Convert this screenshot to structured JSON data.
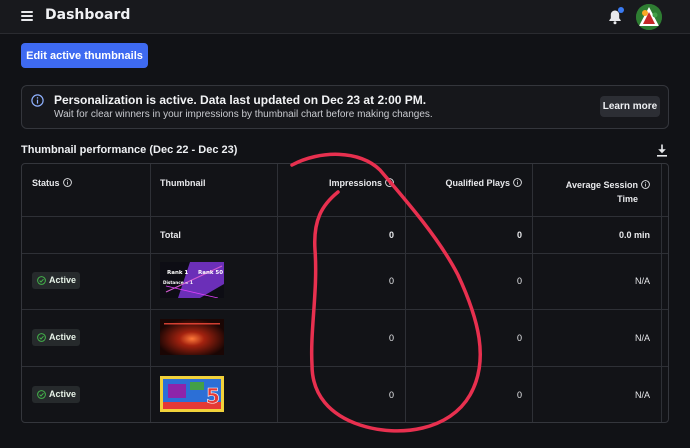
{
  "header": {
    "title": "Dashboard",
    "menu_icon": "hamburger-menu-icon",
    "notification_icon": "bell-icon",
    "notification_dot_color": "#3a7bf3"
  },
  "actions": {
    "edit_label": "Edit active thumbnails",
    "accent": "#3e6af1"
  },
  "info": {
    "title": "Personalization is active. Data last updated on Dec 23 at 2:00 PM.",
    "subtitle": "Wait for clear winners in your impressions by thumbnail chart before making changes.",
    "learn_more": "Learn more",
    "icon": "info-circle-icon"
  },
  "section": {
    "title": "Thumbnail performance (Dec 22 - Dec 23)",
    "download_icon": "download-icon"
  },
  "table": {
    "columns": {
      "status": "Status",
      "thumbnail": "Thumbnail",
      "impressions": "Impressions",
      "plays": "Qualified Plays",
      "session_line1": "Average Session",
      "session_line2": "Time"
    },
    "total": {
      "label": "Total",
      "impressions": "0",
      "plays": "0",
      "session": "0.0 min"
    },
    "rows": [
      {
        "status": "Active",
        "impressions": "0",
        "plays": "0",
        "session": "N/A",
        "thumb": {
          "rank_a": "Rank 1",
          "rank_b": "Rank 50",
          "distance": "Distance = 1"
        }
      },
      {
        "status": "Active",
        "impressions": "0",
        "plays": "0",
        "session": "N/A"
      },
      {
        "status": "Active",
        "impressions": "0",
        "plays": "0",
        "session": "N/A",
        "thumb": {
          "number": "5"
        }
      }
    ],
    "active_color": "#43b14a"
  }
}
